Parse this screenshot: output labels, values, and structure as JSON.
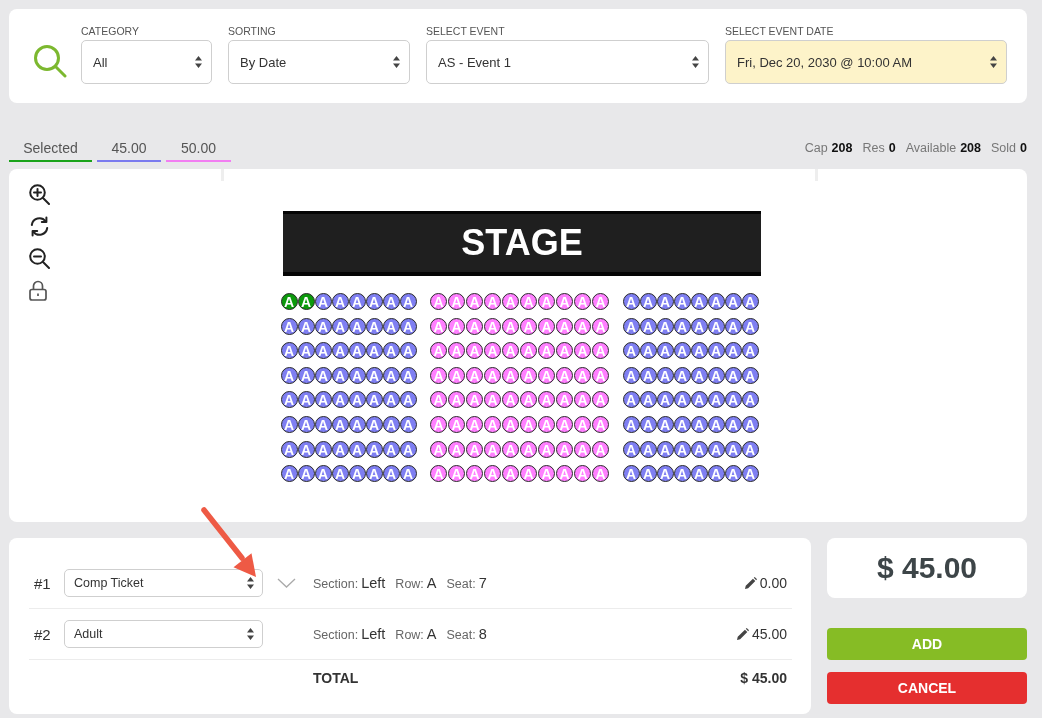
{
  "filters": [
    {
      "label": "CATEGORY",
      "value": "All",
      "highlighted": false
    },
    {
      "label": "SORTING",
      "value": "By Date",
      "highlighted": false
    },
    {
      "label": "SELECT EVENT",
      "value": "AS - Event 1",
      "highlighted": false
    },
    {
      "label": "SELECT EVENT DATE",
      "value": "Fri, Dec 20, 2030 @ 10:00 AM",
      "highlighted": true
    }
  ],
  "tabs": [
    {
      "label": "Selected",
      "color": "#1aa31a"
    },
    {
      "label": "45.00",
      "color": "#7b7bef"
    },
    {
      "label": "50.00",
      "color": "#f27ef2"
    }
  ],
  "stats": [
    {
      "label": "Cap",
      "value": "208"
    },
    {
      "label": "Res",
      "value": "0"
    },
    {
      "label": "Available",
      "value": "208"
    },
    {
      "label": "Sold",
      "value": "0"
    }
  ],
  "seat_map": {
    "stage_label": "STAGE",
    "sections": [
      {
        "color": "#7f7ff2",
        "rows": [
          {
            "seats": [
              {
                "label": "A",
                "selected": true
              },
              {
                "label": "A",
                "selected": true
              },
              {
                "label": "A",
                "selected": false
              },
              {
                "label": "A",
                "selected": false
              },
              {
                "label": "A",
                "selected": false
              },
              {
                "label": "A",
                "selected": false
              },
              {
                "label": "A",
                "selected": false
              },
              {
                "label": "A",
                "selected": false
              }
            ]
          },
          {
            "seats": [
              {
                "label": "A",
                "selected": false
              },
              {
                "label": "A",
                "selected": false
              },
              {
                "label": "A",
                "selected": false
              },
              {
                "label": "A",
                "selected": false
              },
              {
                "label": "A",
                "selected": false
              },
              {
                "label": "A",
                "selected": false
              },
              {
                "label": "A",
                "selected": false
              },
              {
                "label": "A",
                "selected": false
              }
            ]
          },
          {
            "seats": [
              {
                "label": "A",
                "selected": false
              },
              {
                "label": "A",
                "selected": false
              },
              {
                "label": "A",
                "selected": false
              },
              {
                "label": "A",
                "selected": false
              },
              {
                "label": "A",
                "selected": false
              },
              {
                "label": "A",
                "selected": false
              },
              {
                "label": "A",
                "selected": false
              },
              {
                "label": "A",
                "selected": false
              }
            ]
          },
          {
            "seats": [
              {
                "label": "A",
                "selected": false
              },
              {
                "label": "A",
                "selected": false
              },
              {
                "label": "A",
                "selected": false
              },
              {
                "label": "A",
                "selected": false
              },
              {
                "label": "A",
                "selected": false
              },
              {
                "label": "A",
                "selected": false
              },
              {
                "label": "A",
                "selected": false
              },
              {
                "label": "A",
                "selected": false
              }
            ]
          },
          {
            "seats": [
              {
                "label": "A",
                "selected": false
              },
              {
                "label": "A",
                "selected": false
              },
              {
                "label": "A",
                "selected": false
              },
              {
                "label": "A",
                "selected": false
              },
              {
                "label": "A",
                "selected": false
              },
              {
                "label": "A",
                "selected": false
              },
              {
                "label": "A",
                "selected": false
              },
              {
                "label": "A",
                "selected": false
              }
            ]
          },
          {
            "seats": [
              {
                "label": "A",
                "selected": false
              },
              {
                "label": "A",
                "selected": false
              },
              {
                "label": "A",
                "selected": false
              },
              {
                "label": "A",
                "selected": false
              },
              {
                "label": "A",
                "selected": false
              },
              {
                "label": "A",
                "selected": false
              },
              {
                "label": "A",
                "selected": false
              },
              {
                "label": "A",
                "selected": false
              }
            ]
          },
          {
            "seats": [
              {
                "label": "A",
                "selected": false
              },
              {
                "label": "A",
                "selected": false
              },
              {
                "label": "A",
                "selected": false
              },
              {
                "label": "A",
                "selected": false
              },
              {
                "label": "A",
                "selected": false
              },
              {
                "label": "A",
                "selected": false
              },
              {
                "label": "A",
                "selected": false
              },
              {
                "label": "A",
                "selected": false
              }
            ]
          },
          {
            "seats": [
              {
                "label": "A",
                "selected": false
              },
              {
                "label": "A",
                "selected": false
              },
              {
                "label": "A",
                "selected": false
              },
              {
                "label": "A",
                "selected": false
              },
              {
                "label": "A",
                "selected": false
              },
              {
                "label": "A",
                "selected": false
              },
              {
                "label": "A",
                "selected": false
              },
              {
                "label": "A",
                "selected": false
              }
            ]
          }
        ]
      },
      {
        "color": "#ff80ff",
        "rows": [
          {
            "seats": [
              {
                "label": "A",
                "selected": false
              },
              {
                "label": "A",
                "selected": false
              },
              {
                "label": "A",
                "selected": false
              },
              {
                "label": "A",
                "selected": false
              },
              {
                "label": "A",
                "selected": false
              },
              {
                "label": "A",
                "selected": false
              },
              {
                "label": "A",
                "selected": false
              },
              {
                "label": "A",
                "selected": false
              },
              {
                "label": "A",
                "selected": false
              },
              {
                "label": "A",
                "selected": false
              }
            ]
          },
          {
            "seats": [
              {
                "label": "A",
                "selected": false
              },
              {
                "label": "A",
                "selected": false
              },
              {
                "label": "A",
                "selected": false
              },
              {
                "label": "A",
                "selected": false
              },
              {
                "label": "A",
                "selected": false
              },
              {
                "label": "A",
                "selected": false
              },
              {
                "label": "A",
                "selected": false
              },
              {
                "label": "A",
                "selected": false
              },
              {
                "label": "A",
                "selected": false
              },
              {
                "label": "A",
                "selected": false
              }
            ]
          },
          {
            "seats": [
              {
                "label": "A",
                "selected": false
              },
              {
                "label": "A",
                "selected": false
              },
              {
                "label": "A",
                "selected": false
              },
              {
                "label": "A",
                "selected": false
              },
              {
                "label": "A",
                "selected": false
              },
              {
                "label": "A",
                "selected": false
              },
              {
                "label": "A",
                "selected": false
              },
              {
                "label": "A",
                "selected": false
              },
              {
                "label": "A",
                "selected": false
              },
              {
                "label": "A",
                "selected": false
              }
            ]
          },
          {
            "seats": [
              {
                "label": "A",
                "selected": false
              },
              {
                "label": "A",
                "selected": false
              },
              {
                "label": "A",
                "selected": false
              },
              {
                "label": "A",
                "selected": false
              },
              {
                "label": "A",
                "selected": false
              },
              {
                "label": "A",
                "selected": false
              },
              {
                "label": "A",
                "selected": false
              },
              {
                "label": "A",
                "selected": false
              },
              {
                "label": "A",
                "selected": false
              },
              {
                "label": "A",
                "selected": false
              }
            ]
          },
          {
            "seats": [
              {
                "label": "A",
                "selected": false
              },
              {
                "label": "A",
                "selected": false
              },
              {
                "label": "A",
                "selected": false
              },
              {
                "label": "A",
                "selected": false
              },
              {
                "label": "A",
                "selected": false
              },
              {
                "label": "A",
                "selected": false
              },
              {
                "label": "A",
                "selected": false
              },
              {
                "label": "A",
                "selected": false
              },
              {
                "label": "A",
                "selected": false
              },
              {
                "label": "A",
                "selected": false
              }
            ]
          },
          {
            "seats": [
              {
                "label": "A",
                "selected": false
              },
              {
                "label": "A",
                "selected": false
              },
              {
                "label": "A",
                "selected": false
              },
              {
                "label": "A",
                "selected": false
              },
              {
                "label": "A",
                "selected": false
              },
              {
                "label": "A",
                "selected": false
              },
              {
                "label": "A",
                "selected": false
              },
              {
                "label": "A",
                "selected": false
              },
              {
                "label": "A",
                "selected": false
              },
              {
                "label": "A",
                "selected": false
              }
            ]
          },
          {
            "seats": [
              {
                "label": "A",
                "selected": false
              },
              {
                "label": "A",
                "selected": false
              },
              {
                "label": "A",
                "selected": false
              },
              {
                "label": "A",
                "selected": false
              },
              {
                "label": "A",
                "selected": false
              },
              {
                "label": "A",
                "selected": false
              },
              {
                "label": "A",
                "selected": false
              },
              {
                "label": "A",
                "selected": false
              },
              {
                "label": "A",
                "selected": false
              },
              {
                "label": "A",
                "selected": false
              }
            ]
          },
          {
            "seats": [
              {
                "label": "A",
                "selected": false
              },
              {
                "label": "A",
                "selected": false
              },
              {
                "label": "A",
                "selected": false
              },
              {
                "label": "A",
                "selected": false
              },
              {
                "label": "A",
                "selected": false
              },
              {
                "label": "A",
                "selected": false
              },
              {
                "label": "A",
                "selected": false
              },
              {
                "label": "A",
                "selected": false
              },
              {
                "label": "A",
                "selected": false
              },
              {
                "label": "A",
                "selected": false
              }
            ]
          }
        ]
      },
      {
        "color": "#7f7ff2",
        "rows": [
          {
            "seats": [
              {
                "label": "A",
                "selected": false
              },
              {
                "label": "A",
                "selected": false
              },
              {
                "label": "A",
                "selected": false
              },
              {
                "label": "A",
                "selected": false
              },
              {
                "label": "A",
                "selected": false
              },
              {
                "label": "A",
                "selected": false
              },
              {
                "label": "A",
                "selected": false
              },
              {
                "label": "A",
                "selected": false
              }
            ]
          },
          {
            "seats": [
              {
                "label": "A",
                "selected": false
              },
              {
                "label": "A",
                "selected": false
              },
              {
                "label": "A",
                "selected": false
              },
              {
                "label": "A",
                "selected": false
              },
              {
                "label": "A",
                "selected": false
              },
              {
                "label": "A",
                "selected": false
              },
              {
                "label": "A",
                "selected": false
              },
              {
                "label": "A",
                "selected": false
              }
            ]
          },
          {
            "seats": [
              {
                "label": "A",
                "selected": false
              },
              {
                "label": "A",
                "selected": false
              },
              {
                "label": "A",
                "selected": false
              },
              {
                "label": "A",
                "selected": false
              },
              {
                "label": "A",
                "selected": false
              },
              {
                "label": "A",
                "selected": false
              },
              {
                "label": "A",
                "selected": false
              },
              {
                "label": "A",
                "selected": false
              }
            ]
          },
          {
            "seats": [
              {
                "label": "A",
                "selected": false
              },
              {
                "label": "A",
                "selected": false
              },
              {
                "label": "A",
                "selected": false
              },
              {
                "label": "A",
                "selected": false
              },
              {
                "label": "A",
                "selected": false
              },
              {
                "label": "A",
                "selected": false
              },
              {
                "label": "A",
                "selected": false
              },
              {
                "label": "A",
                "selected": false
              }
            ]
          },
          {
            "seats": [
              {
                "label": "A",
                "selected": false
              },
              {
                "label": "A",
                "selected": false
              },
              {
                "label": "A",
                "selected": false
              },
              {
                "label": "A",
                "selected": false
              },
              {
                "label": "A",
                "selected": false
              },
              {
                "label": "A",
                "selected": false
              },
              {
                "label": "A",
                "selected": false
              },
              {
                "label": "A",
                "selected": false
              }
            ]
          },
          {
            "seats": [
              {
                "label": "A",
                "selected": false
              },
              {
                "label": "A",
                "selected": false
              },
              {
                "label": "A",
                "selected": false
              },
              {
                "label": "A",
                "selected": false
              },
              {
                "label": "A",
                "selected": false
              },
              {
                "label": "A",
                "selected": false
              },
              {
                "label": "A",
                "selected": false
              },
              {
                "label": "A",
                "selected": false
              }
            ]
          },
          {
            "seats": [
              {
                "label": "A",
                "selected": false
              },
              {
                "label": "A",
                "selected": false
              },
              {
                "label": "A",
                "selected": false
              },
              {
                "label": "A",
                "selected": false
              },
              {
                "label": "A",
                "selected": false
              },
              {
                "label": "A",
                "selected": false
              },
              {
                "label": "A",
                "selected": false
              },
              {
                "label": "A",
                "selected": false
              }
            ]
          },
          {
            "seats": [
              {
                "label": "A",
                "selected": false
              },
              {
                "label": "A",
                "selected": false
              },
              {
                "label": "A",
                "selected": false
              },
              {
                "label": "A",
                "selected": false
              },
              {
                "label": "A",
                "selected": false
              },
              {
                "label": "A",
                "selected": false
              },
              {
                "label": "A",
                "selected": false
              },
              {
                "label": "A",
                "selected": false
              }
            ]
          }
        ]
      }
    ]
  },
  "ticket_rows": [
    {
      "number": "#1",
      "ticket_type": "Comp Ticket",
      "chevron": true,
      "details": [
        {
          "label": "Section:",
          "value": "Left"
        },
        {
          "label": "Row:",
          "value": "A"
        },
        {
          "label": "Seat:",
          "value": "7"
        }
      ],
      "price": "0.00"
    },
    {
      "number": "#2",
      "ticket_type": "Adult",
      "chevron": false,
      "details": [
        {
          "label": "Section:",
          "value": "Left"
        },
        {
          "label": "Row:",
          "value": "A"
        },
        {
          "label": "Seat:",
          "value": "8"
        }
      ],
      "price": "45.00"
    }
  ],
  "total": {
    "label": "TOTAL",
    "value": "$ 45.00"
  },
  "summary": {
    "price": "$ 45.00"
  },
  "buttons": [
    {
      "label": "ADD",
      "kind": "primary"
    },
    {
      "label": "CANCEL",
      "kind": "danger"
    }
  ]
}
